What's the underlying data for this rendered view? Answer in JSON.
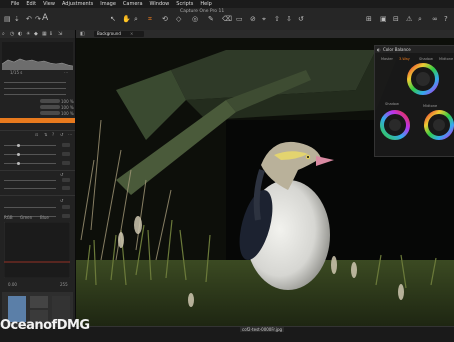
{
  "menubar": {
    "items": [
      "File",
      "Edit",
      "View",
      "Adjustments",
      "Image",
      "Camera",
      "Window",
      "Scripts",
      "Help"
    ]
  },
  "window": {
    "title": "Capture One Pro 11"
  },
  "viewer": {
    "tab_label": "Background",
    "filename": "cof2-test-0000Fr.jpg"
  },
  "left_panel": {
    "histogram_label": "1/15 s",
    "percent_values": [
      "100 %",
      "100 %",
      "100 %"
    ],
    "stepper_values": [
      "0",
      "0",
      "0",
      "0",
      "0"
    ],
    "curve_tabs": [
      "RGB",
      "Green",
      "Blue"
    ],
    "curve_values": [
      "0.00",
      "255"
    ]
  },
  "color_balance": {
    "title": "Color Balance",
    "tabs": [
      "Master",
      "3-Way",
      "Shadow",
      "Midtone"
    ],
    "active_tab": "3-Way",
    "wheel_labels": [
      "Shadow",
      "Midtone"
    ]
  },
  "watermark": {
    "text_a": "Oceanof",
    "text_b": "DMG"
  },
  "colors": {
    "accent": "#e87a1e",
    "panel": "#222222",
    "toolbar": "#262626"
  }
}
